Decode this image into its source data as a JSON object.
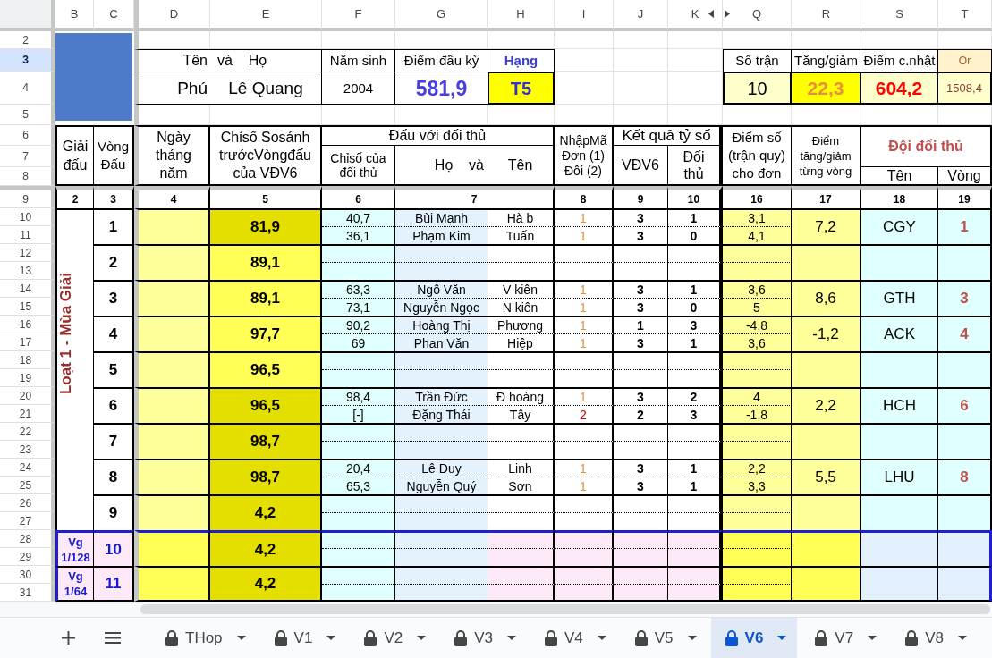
{
  "column_headers": [
    "B",
    "C",
    "D",
    "E",
    "F",
    "G",
    "H",
    "I",
    "J",
    "K",
    "Q",
    "R",
    "S",
    "T"
  ],
  "row_headers": [
    {
      "label": "2",
      "selected": false
    },
    {
      "label": "3",
      "selected": true
    },
    {
      "label": "4",
      "selected": false
    },
    {
      "label": "5",
      "selected": false
    },
    {
      "label": "6",
      "selected": false
    },
    {
      "label": "7",
      "selected": false
    },
    {
      "label": "8",
      "selected": false
    },
    {
      "label": "9",
      "selected": false
    },
    {
      "label": "10",
      "selected": false
    },
    {
      "label": "11",
      "selected": false
    },
    {
      "label": "12",
      "selected": false
    },
    {
      "label": "13",
      "selected": false
    },
    {
      "label": "14",
      "selected": false
    },
    {
      "label": "15",
      "selected": false
    },
    {
      "label": "16",
      "selected": false
    },
    {
      "label": "17",
      "selected": false
    },
    {
      "label": "18",
      "selected": false
    },
    {
      "label": "19",
      "selected": false
    },
    {
      "label": "20",
      "selected": false
    },
    {
      "label": "21",
      "selected": false
    },
    {
      "label": "22",
      "selected": false
    },
    {
      "label": "23",
      "selected": false
    },
    {
      "label": "24",
      "selected": false
    },
    {
      "label": "25",
      "selected": false
    },
    {
      "label": "26",
      "selected": false
    },
    {
      "label": "27",
      "selected": false
    },
    {
      "label": "28",
      "selected": false
    },
    {
      "label": "29",
      "selected": false
    },
    {
      "label": "30",
      "selected": false
    },
    {
      "label": "31",
      "selected": false
    }
  ],
  "profile": {
    "name_label": "Tên",
    "name_label_rest": "và    Họ",
    "first_name": "Phú",
    "last_name": "Lê Quang",
    "birth_year_label": "Năm sinh",
    "birth_year": "2004",
    "start_points_label": "Điểm đầu kỳ",
    "start_points": "581,9",
    "rank_label": "Hạng",
    "rank": "T5"
  },
  "summary": {
    "matches_label": "Số trận",
    "matches": "10",
    "change_label": "Tăng/giảm",
    "change": "22,3",
    "current_label": "Điểm c.nhật",
    "current": "604,2",
    "rating_label": "Or",
    "rating": "1508,4"
  },
  "table": {
    "headers": {
      "tournament": "Giải đấu",
      "round": "Vòng Đấu",
      "date": "Ngày tháng năm",
      "comparison_index": "Chỉsố Sosánh trướcVòngđấu của VĐV6",
      "opponent": "Đấu với đối thủ",
      "opponent_index": "Chỉsố của đối thủ",
      "opponent_surname": "Họ    và",
      "opponent_name": "Tên",
      "match_type": "NhậpMã Đơn (1) Đôi (2)",
      "result": "Kết quả tỷ số",
      "player_score": "VĐV6",
      "opponent_score": "Đối thủ",
      "match_points": "Điểm số (trận quy) cho đơn",
      "round_change": "Điểm tăng/giảm từng vòng",
      "opponent_team": "Đội đối thủ",
      "team_name": "Tên",
      "team_round": "Vòng"
    },
    "column_numbers": [
      "2",
      "3",
      "4",
      "5",
      "6",
      "7",
      "8",
      "9",
      "10",
      "16",
      "17",
      "18",
      "19"
    ],
    "stages": [
      {
        "kind": "season",
        "label": "Loạt 1 - Mùa Giải",
        "rounds": [
          {
            "round": "1",
            "index": "81,9",
            "color": "#e5df00",
            "matches": [
              {
                "opponent_index": "40,7",
                "surname": "Bùi Mạnh",
                "name": "Hà b",
                "type": "1",
                "color": "#e69138",
                "player_score": "3",
                "opponent_score": "1",
                "points": "3,1"
              },
              {
                "opponent_index": "36,1",
                "surname": "Phạm Kim",
                "name": "Tuấn",
                "type": "1",
                "color": "#e69138",
                "player_score": "3",
                "opponent_score": "0",
                "points": "4,1"
              }
            ],
            "round_change": "7,2",
            "team": "CGY",
            "team_round": "1"
          },
          {
            "round": "2",
            "index": "89,1",
            "color": "#ffff55"
          },
          {
            "round": "3",
            "index": "89,1",
            "color": "#ffff55",
            "matches": [
              {
                "opponent_index": "63,3",
                "surname": "Ngô Văn",
                "name": "V kiên",
                "type": "1",
                "color": "#e69138",
                "player_score": "3",
                "opponent_score": "1",
                "points": "3,6"
              },
              {
                "opponent_index": "73,1",
                "surname": "Nguyễn Ngọc",
                "name": "N kiên",
                "type": "1",
                "color": "#e69138",
                "player_score": "3",
                "opponent_score": "0",
                "points": "5"
              }
            ],
            "round_change": "8,6",
            "team": "GTH",
            "team_round": "3"
          },
          {
            "round": "4",
            "index": "97,7",
            "color": "#ffff55",
            "matches": [
              {
                "opponent_index": "90,2",
                "surname": "Hoàng Thị",
                "name": "Phương",
                "type": "1",
                "color": "#e69138",
                "player_score": "1",
                "opponent_score": "3",
                "points": "-4,8"
              },
              {
                "opponent_index": "69",
                "surname": "Phan Văn",
                "name": "Hiệp",
                "type": "1",
                "color": "#e69138",
                "player_score": "3",
                "opponent_score": "1",
                "points": "3,6"
              }
            ],
            "round_change": "-1,2",
            "team": "ACK",
            "team_round": "4"
          },
          {
            "round": "5",
            "index": "96,5",
            "color": "#ffff55"
          },
          {
            "round": "6",
            "index": "96,5",
            "color": "#e5df00",
            "matches": [
              {
                "opponent_index": "98,4",
                "surname": "Trần Đức",
                "name": "Đ hoàng",
                "type": "1",
                "color": "#e69138",
                "player_score": "3",
                "opponent_score": "2",
                "points": "4"
              },
              {
                "opponent_index": "[-]",
                "surname": "Đặng Thái",
                "name": "Tây",
                "type": "2",
                "color": "#cc0000",
                "player_score": "2",
                "opponent_score": "3",
                "points": "-1,8"
              }
            ],
            "round_change": "2,2",
            "team": "HCH",
            "team_round": "6"
          },
          {
            "round": "7",
            "index": "98,7",
            "color": "#e5df00"
          },
          {
            "round": "8",
            "index": "98,7",
            "color": "#e5df00",
            "matches": [
              {
                "opponent_index": "20,4",
                "surname": "Lê Duy",
                "name": "Linh",
                "type": "1",
                "color": "#e69138",
                "player_score": "3",
                "opponent_score": "1",
                "points": "2,2"
              },
              {
                "opponent_index": "65,3",
                "surname": "Nguyễn Quý",
                "name": "Sơn",
                "type": "1",
                "color": "#e69138",
                "player_score": "3",
                "opponent_score": "1",
                "points": "3,3"
              }
            ],
            "round_change": "5,5",
            "team": "LHU",
            "team_round": "8"
          },
          {
            "round": "9",
            "index": "4,2",
            "color": "#e5df00"
          }
        ]
      },
      {
        "kind": "knockout",
        "label": "Vg 1/128",
        "rounds": [
          {
            "round": "10",
            "index": "4,2",
            "color": "#e5df00"
          }
        ]
      },
      {
        "kind": "knockout",
        "label": "Vg 1/64",
        "rounds": [
          {
            "round": "11",
            "index": "4,2",
            "color": "#e5df00"
          }
        ]
      }
    ]
  },
  "sheet_tabs": [
    {
      "label": "THop",
      "selected": false,
      "locked": true
    },
    {
      "label": "V1",
      "selected": false,
      "locked": true
    },
    {
      "label": "V2",
      "selected": false,
      "locked": true
    },
    {
      "label": "V3",
      "selected": false,
      "locked": true
    },
    {
      "label": "V4",
      "selected": false,
      "locked": true
    },
    {
      "label": "V5",
      "selected": false,
      "locked": true
    },
    {
      "label": "V6",
      "selected": true,
      "locked": true
    },
    {
      "label": "V7",
      "selected": false,
      "locked": true
    },
    {
      "label": "V8",
      "selected": false,
      "locked": true
    }
  ]
}
